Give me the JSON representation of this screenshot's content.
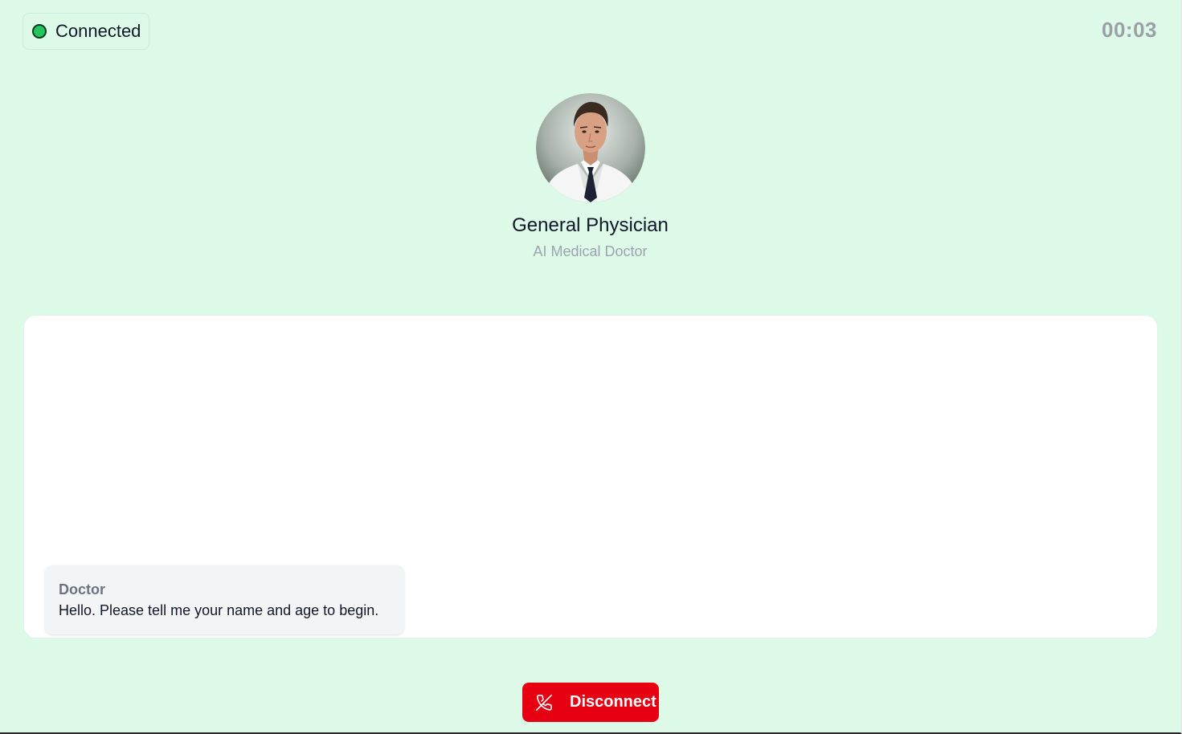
{
  "status": {
    "label": "Connected",
    "color": "#22c55e"
  },
  "timer": {
    "value": "00:03"
  },
  "doctor": {
    "name": "General Physician",
    "subtitle": "AI Medical Doctor",
    "avatar_icon": "doctor-avatar-photo"
  },
  "transcript": {
    "messages": [
      {
        "sender": "Doctor",
        "text": "Hello. Please tell me your name and age to begin."
      }
    ]
  },
  "actions": {
    "disconnect_label": "Disconnect",
    "disconnect_icon": "phone-off-icon",
    "disconnect_color": "#e60012"
  },
  "colors": {
    "background": "#dcfae7",
    "panel": "#ffffff",
    "bubble": "#f3f4f6"
  }
}
